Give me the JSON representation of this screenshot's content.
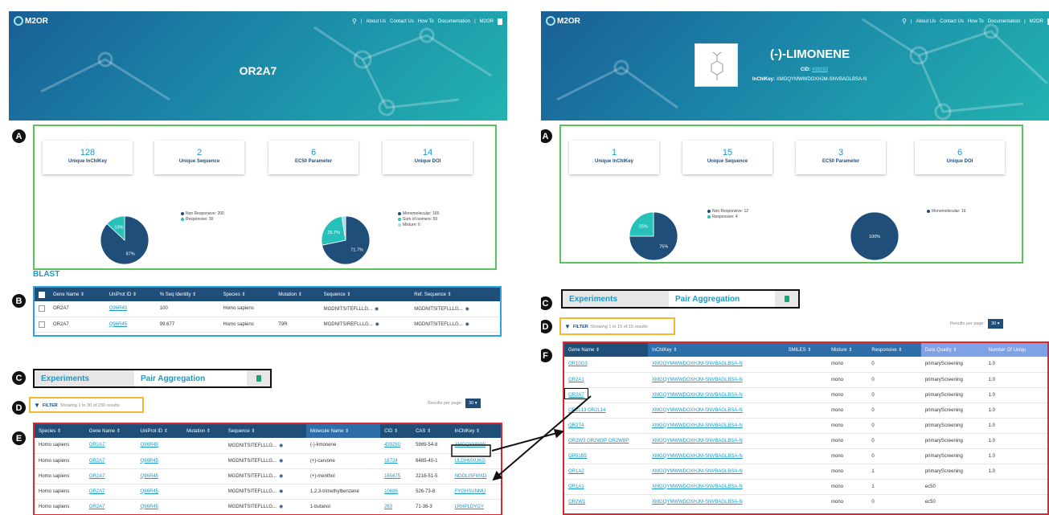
{
  "nav": {
    "brand": "M2OR",
    "search_icon": "search-icon",
    "separator": "|",
    "links": [
      "About Us",
      "Contact Us",
      "How To",
      "Documentation"
    ],
    "m2or_label": "M2OR"
  },
  "markers": {
    "a": "A",
    "b": "B",
    "c": "C",
    "d": "D",
    "e": "E",
    "f": "F"
  },
  "left": {
    "title": "OR2A7",
    "stats": [
      {
        "value": "128",
        "label": "Unique InChIKey"
      },
      {
        "value": "2",
        "label": "Unique Sequence"
      },
      {
        "value": "6",
        "label": "EC50 Parameter"
      },
      {
        "value": "14",
        "label": "Unique DOI"
      }
    ],
    "pie1": {
      "slices": [
        {
          "name": "Non Responsive: 200",
          "value": 87,
          "label": "87%",
          "color": "#1f4e79"
        },
        {
          "name": "Responsive: 30",
          "value": 13,
          "label": "13%",
          "color": "#26c1bb"
        }
      ]
    },
    "pie2": {
      "slices": [
        {
          "name": "Monomolecular: 165",
          "value": 71.7,
          "label": "71.7%",
          "color": "#1f4e79"
        },
        {
          "name": "Sum of isomers: 59",
          "value": 25.7,
          "label": "25.7%",
          "color": "#26c1bb"
        },
        {
          "name": "Mixture: 6",
          "value": 2.6,
          "label": "",
          "color": "#a4dbe6"
        }
      ]
    },
    "blast": {
      "title": "BLAST",
      "headers": [
        "Gene Name",
        "UniProt ID",
        "% Seq Identity",
        "Species",
        "Mutation",
        "Sequence",
        "Ref. Sequence"
      ],
      "rows": [
        [
          "OR2A7",
          "Q96R45",
          "100",
          "Homo sapiens",
          "",
          "MGDNITSITEFLLLG...",
          "MGDNITSITEFLLLG..."
        ],
        [
          "OR2A7",
          "Q96R45",
          "99.677",
          "Homo sapiens",
          "T9R",
          "MGDNITSIREFLLLG...",
          "MGDNITSITEFLLLG..."
        ]
      ]
    },
    "tabs": {
      "experiments": "Experiments",
      "pair": "Pair Aggregation"
    },
    "filter": {
      "label": "FILTER",
      "summary": "Showing 1 to 30 of 230 results"
    },
    "rpp": {
      "label": "Results per page:",
      "value": "30 ▾"
    },
    "experiments": {
      "headers": [
        "Species",
        "Gene Name",
        "UniProt ID",
        "Mutation",
        "Sequence",
        "Molecule Name",
        "CID",
        "CAS",
        "InChIKey"
      ],
      "rows": [
        [
          "Homo sapiens",
          "OR2A7",
          "Q96R45",
          "",
          "MGDNITSITEFLLLG...",
          "(-)-limonene",
          "439250",
          "5989-54-8",
          "XMGQYMWW"
        ],
        [
          "Homo sapiens",
          "OR2A7",
          "Q96R45",
          "",
          "MGDNITSITEFLLLG...",
          "(+)-carvone",
          "16724",
          "6485-40-1",
          "ULDHMXUKG"
        ],
        [
          "Homo sapiens",
          "OR2A7",
          "Q96R45",
          "",
          "MGDNITSITEFLLLG...",
          "(+)-menthol",
          "165675",
          "2216-51-5",
          "NOOLISFMXD"
        ],
        [
          "Homo sapiens",
          "OR2A7",
          "Q96R45",
          "",
          "MGDNITSITEFLLLG...",
          "1,2,3-trimethylbenzene",
          "10686",
          "526-73-8",
          "FYGHSUNMU"
        ],
        [
          "Homo sapiens",
          "OR2A7",
          "Q96R45",
          "",
          "MGDNITSITEFLLLG...",
          "1-butanol",
          "263",
          "71-36-3",
          "LRHPLDYGY"
        ]
      ]
    }
  },
  "right": {
    "title": "(-)-LIMONENE",
    "cid_label": "CID:",
    "cid": "439250",
    "inchikey_label": "InChIKey:",
    "inchikey": "XMGQYMWWDOXHJM-SNVBAGLBSA-N",
    "stats": [
      {
        "value": "1",
        "label": "Unique InChIKey"
      },
      {
        "value": "15",
        "label": "Unique Sequence"
      },
      {
        "value": "3",
        "label": "EC50 Parameter"
      },
      {
        "value": "6",
        "label": "Unique DOI"
      }
    ],
    "pie1": {
      "slices": [
        {
          "name": "Non Responsive: 12",
          "value": 75,
          "label": "75%",
          "color": "#1f4e79"
        },
        {
          "name": "Responsive: 4",
          "value": 25,
          "label": "25%",
          "color": "#26c1bb"
        }
      ]
    },
    "pie2": {
      "slices": [
        {
          "name": "Monomolecular: 16",
          "value": 100,
          "label": "100%",
          "color": "#1f4e79"
        }
      ]
    },
    "tabs": {
      "experiments": "Experiments",
      "pair": "Pair Aggregation"
    },
    "filter": {
      "label": "FILTER",
      "summary": "Showing 1 to 15 of 15 results"
    },
    "rpp": {
      "label": "Results per page:",
      "value": "30 ▾"
    },
    "pairs": {
      "headers": [
        "Gene Name",
        "InChIKey",
        "SMILES",
        "Mixture",
        "Responsive",
        "Data Quality",
        "Number Of Uniqu"
      ],
      "rows": [
        [
          "OR10G3",
          "XMGQYMWWDOXHJM-SNVBAGLBSA-N",
          "",
          "mono",
          "0",
          "primaryScreening",
          "1.0"
        ],
        [
          "OR2A1",
          "XMGQYMWWDOXHJM-SNVBAGLBSA-N",
          "",
          "mono",
          "0",
          "primaryScreening",
          "1.0"
        ],
        [
          "OR2A7",
          "XMGQYMWWDOXHJM-SNVBAGLBSA-N",
          "",
          "mono",
          "0",
          "primaryScreening",
          "1.0"
        ],
        [
          "OR2L13 OR2L14",
          "XMGQYMWWDOXHJM-SNVBAGLBSA-N",
          "",
          "mono",
          "0",
          "primaryScreening",
          "1.0"
        ],
        [
          "OR2T4",
          "XMGQYMWWDOXHJM-SNVBAGLBSA-N",
          "",
          "mono",
          "0",
          "primaryScreening",
          "1.0"
        ],
        [
          "OR2W3 OR2W3P OR2W8P",
          "XMGQYMWWDOXHJM-SNVBAGLBSA-N",
          "",
          "mono",
          "0",
          "primaryScreening",
          "1.0"
        ],
        [
          "OR51B5",
          "XMGQYMWWDOXHJM-SNVBAGLBSA-N",
          "",
          "mono",
          "0",
          "primaryScreening",
          "1.0"
        ],
        [
          "OR1A2",
          "XMGQYMWWDOXHJM-SNVBAGLBSA-N",
          "",
          "mono",
          "1",
          "primaryScreening",
          "1.0"
        ],
        [
          "OR1A1",
          "XMGQYMWWDOXHJM-SNVBAGLBSA-N",
          "",
          "mono",
          "1",
          "ec50",
          ""
        ],
        [
          "OR2W1",
          "XMGQYMWWDOXHJM-SNVBAGLBSA-N",
          "",
          "mono",
          "0",
          "ec50",
          ""
        ]
      ]
    }
  }
}
